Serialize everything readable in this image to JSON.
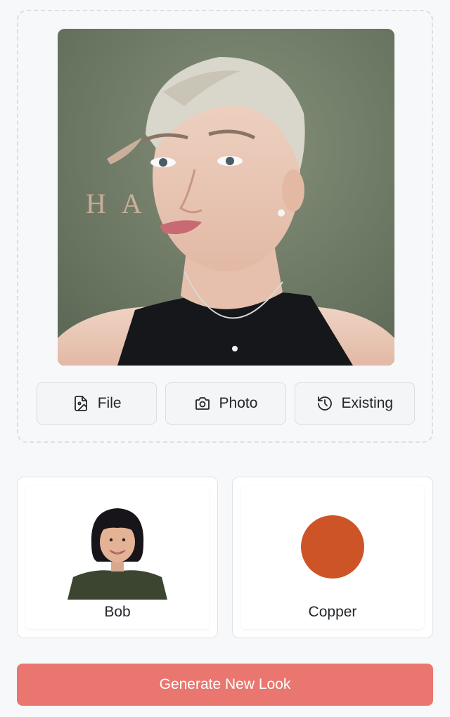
{
  "upload": {
    "photo_alt": "Selfie of a woman with short platinum pixie haircut",
    "sources": [
      {
        "label": "File",
        "icon": "file-image-icon"
      },
      {
        "label": "Photo",
        "icon": "camera-icon"
      },
      {
        "label": "Existing",
        "icon": "history-icon"
      }
    ]
  },
  "options": {
    "style": {
      "label": "Bob",
      "icon": "bob-hairstyle-thumbnail"
    },
    "color": {
      "label": "Copper",
      "swatch": "#cd5427"
    }
  },
  "generate": {
    "label": "Generate New Look",
    "color": "#e9776f"
  }
}
